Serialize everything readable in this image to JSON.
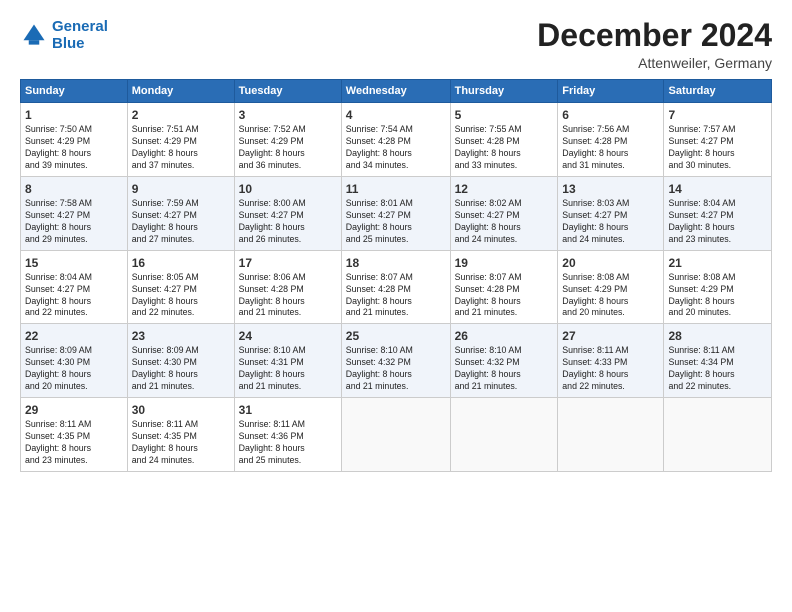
{
  "logo": {
    "line1": "General",
    "line2": "Blue"
  },
  "title": "December 2024",
  "location": "Attenweiler, Germany",
  "weekdays": [
    "Sunday",
    "Monday",
    "Tuesday",
    "Wednesday",
    "Thursday",
    "Friday",
    "Saturday"
  ],
  "weeks": [
    [
      {
        "day": "1",
        "text": "Sunrise: 7:50 AM\nSunset: 4:29 PM\nDaylight: 8 hours\nand 39 minutes."
      },
      {
        "day": "2",
        "text": "Sunrise: 7:51 AM\nSunset: 4:29 PM\nDaylight: 8 hours\nand 37 minutes."
      },
      {
        "day": "3",
        "text": "Sunrise: 7:52 AM\nSunset: 4:29 PM\nDaylight: 8 hours\nand 36 minutes."
      },
      {
        "day": "4",
        "text": "Sunrise: 7:54 AM\nSunset: 4:28 PM\nDaylight: 8 hours\nand 34 minutes."
      },
      {
        "day": "5",
        "text": "Sunrise: 7:55 AM\nSunset: 4:28 PM\nDaylight: 8 hours\nand 33 minutes."
      },
      {
        "day": "6",
        "text": "Sunrise: 7:56 AM\nSunset: 4:28 PM\nDaylight: 8 hours\nand 31 minutes."
      },
      {
        "day": "7",
        "text": "Sunrise: 7:57 AM\nSunset: 4:27 PM\nDaylight: 8 hours\nand 30 minutes."
      }
    ],
    [
      {
        "day": "8",
        "text": "Sunrise: 7:58 AM\nSunset: 4:27 PM\nDaylight: 8 hours\nand 29 minutes."
      },
      {
        "day": "9",
        "text": "Sunrise: 7:59 AM\nSunset: 4:27 PM\nDaylight: 8 hours\nand 27 minutes."
      },
      {
        "day": "10",
        "text": "Sunrise: 8:00 AM\nSunset: 4:27 PM\nDaylight: 8 hours\nand 26 minutes."
      },
      {
        "day": "11",
        "text": "Sunrise: 8:01 AM\nSunset: 4:27 PM\nDaylight: 8 hours\nand 25 minutes."
      },
      {
        "day": "12",
        "text": "Sunrise: 8:02 AM\nSunset: 4:27 PM\nDaylight: 8 hours\nand 24 minutes."
      },
      {
        "day": "13",
        "text": "Sunrise: 8:03 AM\nSunset: 4:27 PM\nDaylight: 8 hours\nand 24 minutes."
      },
      {
        "day": "14",
        "text": "Sunrise: 8:04 AM\nSunset: 4:27 PM\nDaylight: 8 hours\nand 23 minutes."
      }
    ],
    [
      {
        "day": "15",
        "text": "Sunrise: 8:04 AM\nSunset: 4:27 PM\nDaylight: 8 hours\nand 22 minutes."
      },
      {
        "day": "16",
        "text": "Sunrise: 8:05 AM\nSunset: 4:27 PM\nDaylight: 8 hours\nand 22 minutes."
      },
      {
        "day": "17",
        "text": "Sunrise: 8:06 AM\nSunset: 4:28 PM\nDaylight: 8 hours\nand 21 minutes."
      },
      {
        "day": "18",
        "text": "Sunrise: 8:07 AM\nSunset: 4:28 PM\nDaylight: 8 hours\nand 21 minutes."
      },
      {
        "day": "19",
        "text": "Sunrise: 8:07 AM\nSunset: 4:28 PM\nDaylight: 8 hours\nand 21 minutes."
      },
      {
        "day": "20",
        "text": "Sunrise: 8:08 AM\nSunset: 4:29 PM\nDaylight: 8 hours\nand 20 minutes."
      },
      {
        "day": "21",
        "text": "Sunrise: 8:08 AM\nSunset: 4:29 PM\nDaylight: 8 hours\nand 20 minutes."
      }
    ],
    [
      {
        "day": "22",
        "text": "Sunrise: 8:09 AM\nSunset: 4:30 PM\nDaylight: 8 hours\nand 20 minutes."
      },
      {
        "day": "23",
        "text": "Sunrise: 8:09 AM\nSunset: 4:30 PM\nDaylight: 8 hours\nand 21 minutes."
      },
      {
        "day": "24",
        "text": "Sunrise: 8:10 AM\nSunset: 4:31 PM\nDaylight: 8 hours\nand 21 minutes."
      },
      {
        "day": "25",
        "text": "Sunrise: 8:10 AM\nSunset: 4:32 PM\nDaylight: 8 hours\nand 21 minutes."
      },
      {
        "day": "26",
        "text": "Sunrise: 8:10 AM\nSunset: 4:32 PM\nDaylight: 8 hours\nand 21 minutes."
      },
      {
        "day": "27",
        "text": "Sunrise: 8:11 AM\nSunset: 4:33 PM\nDaylight: 8 hours\nand 22 minutes."
      },
      {
        "day": "28",
        "text": "Sunrise: 8:11 AM\nSunset: 4:34 PM\nDaylight: 8 hours\nand 22 minutes."
      }
    ],
    [
      {
        "day": "29",
        "text": "Sunrise: 8:11 AM\nSunset: 4:35 PM\nDaylight: 8 hours\nand 23 minutes."
      },
      {
        "day": "30",
        "text": "Sunrise: 8:11 AM\nSunset: 4:35 PM\nDaylight: 8 hours\nand 24 minutes."
      },
      {
        "day": "31",
        "text": "Sunrise: 8:11 AM\nSunset: 4:36 PM\nDaylight: 8 hours\nand 25 minutes."
      },
      {
        "day": "",
        "text": ""
      },
      {
        "day": "",
        "text": ""
      },
      {
        "day": "",
        "text": ""
      },
      {
        "day": "",
        "text": ""
      }
    ]
  ]
}
